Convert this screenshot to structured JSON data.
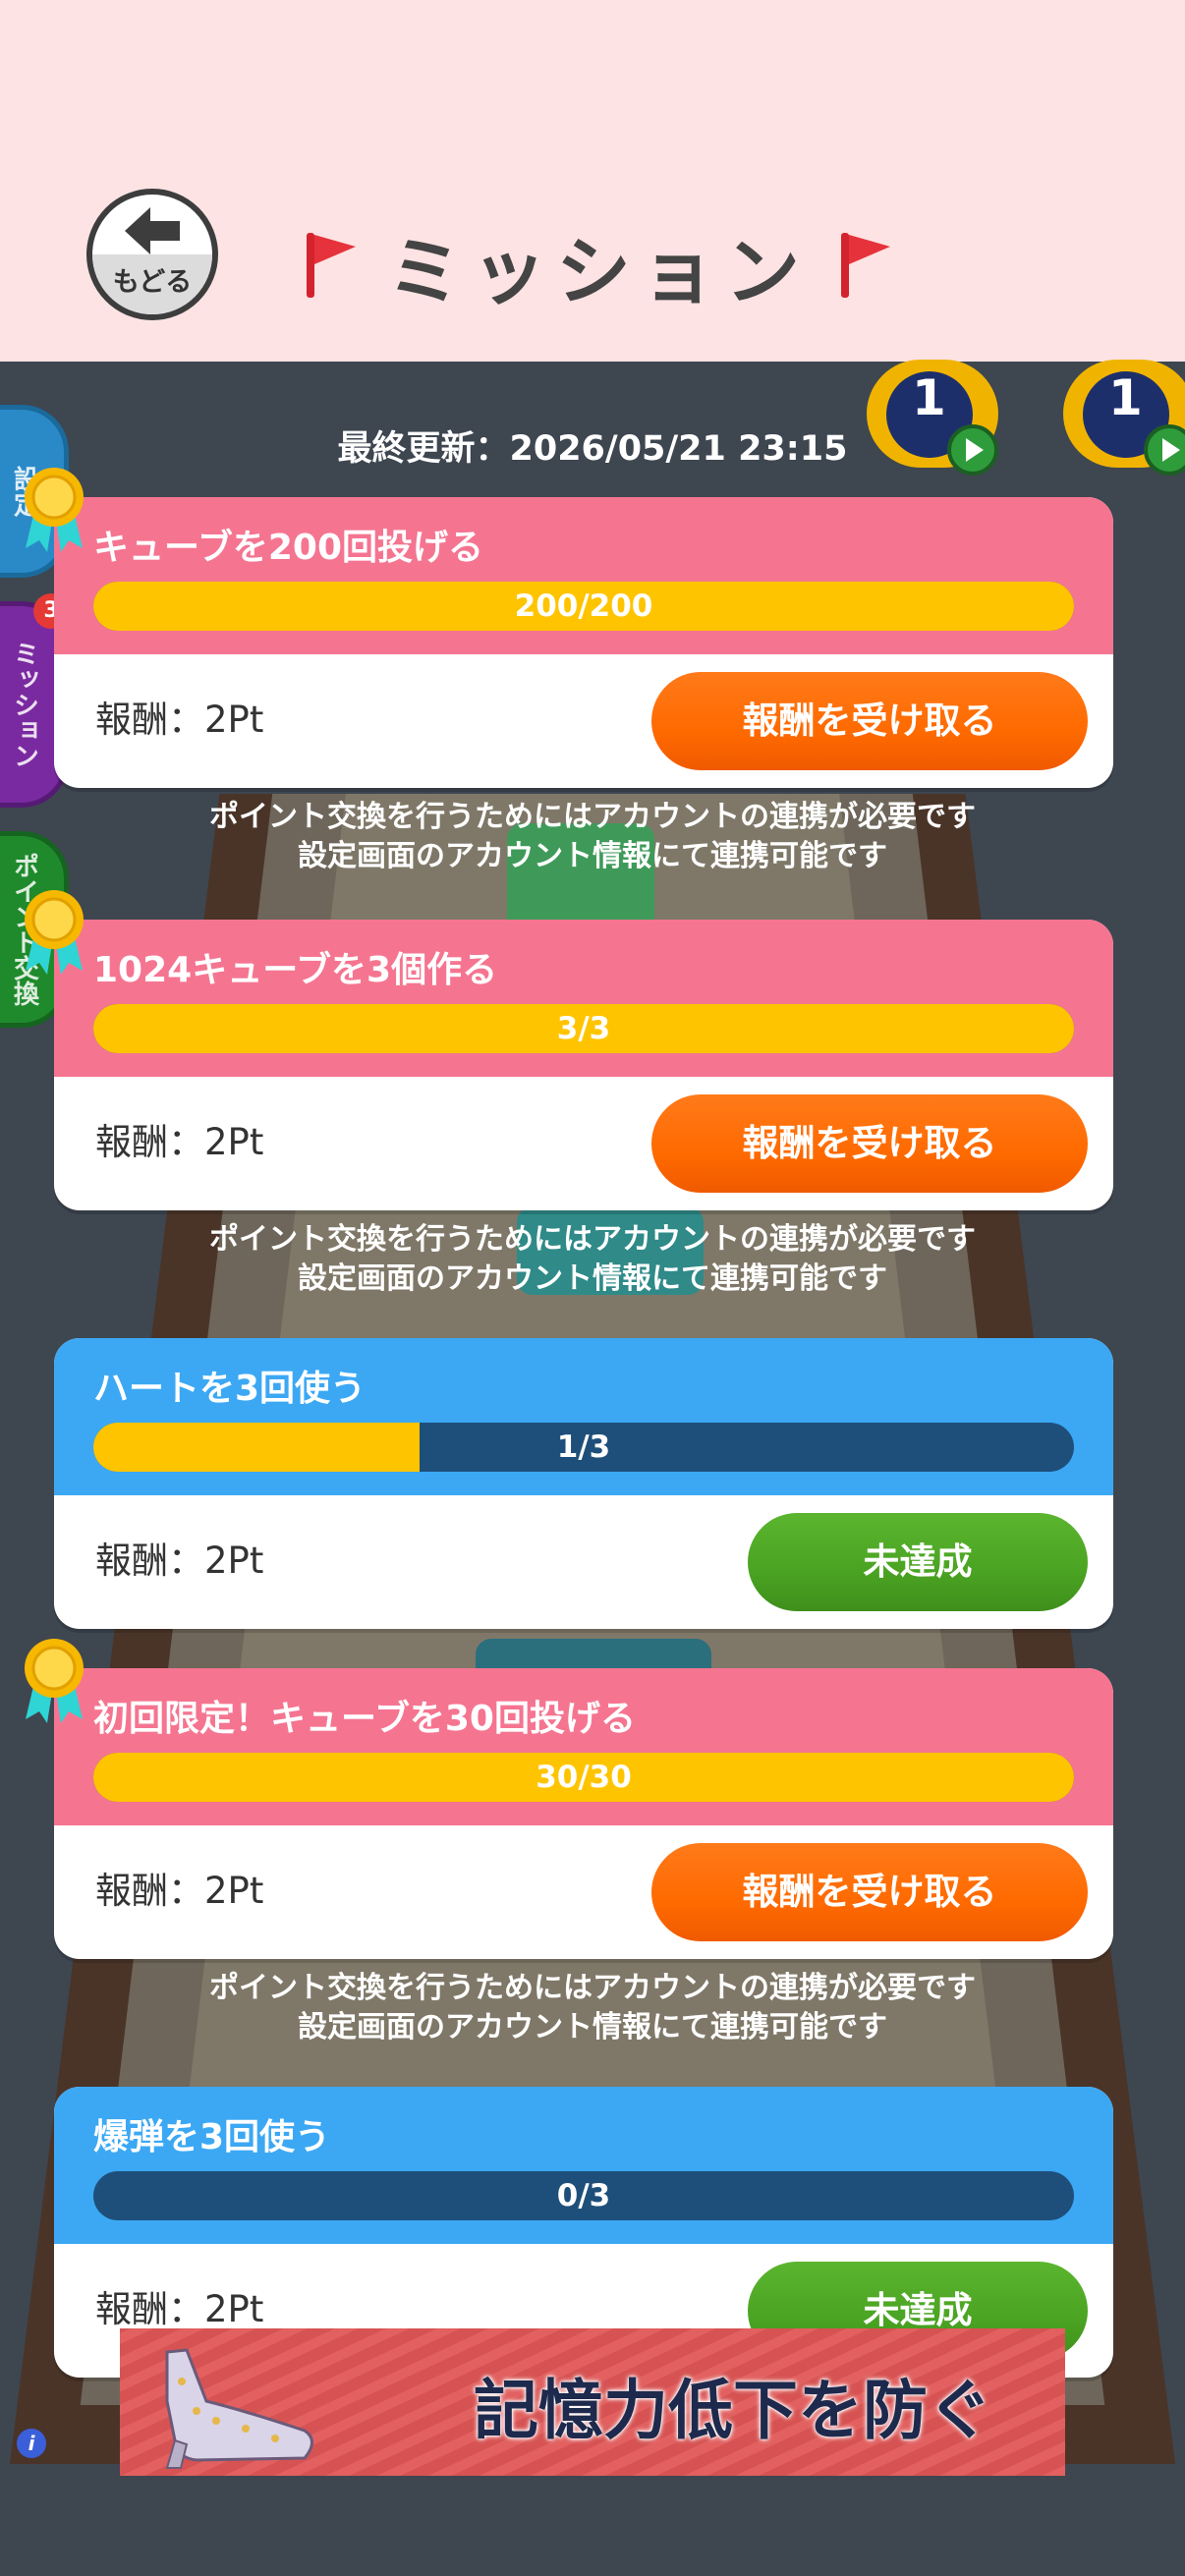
{
  "header": {
    "back_label": "もどる",
    "title": "ミッション"
  },
  "side_tabs": [
    "設定",
    "ミッション",
    "ポイント交換"
  ],
  "side_badge": "3",
  "powerups": [
    {
      "count": "1"
    },
    {
      "count": "1"
    }
  ],
  "last_updated": "最終更新：2026/05/21 23:15",
  "missions": [
    {
      "title": "キューブを200回投げる",
      "progress_text": "200/200",
      "progress": 1.0,
      "reward": "報酬：2Pt",
      "button": "報酬を受け取る",
      "status": "done",
      "note": [
        "ポイント交換を行うためにはアカウントの連携が必要です",
        "設定画面のアカウント情報にて連携可能です"
      ]
    },
    {
      "title": "1024キューブを3個作る",
      "progress_text": "3/3",
      "progress": 1.0,
      "reward": "報酬：2Pt",
      "button": "報酬を受け取る",
      "status": "done",
      "note": [
        "ポイント交換を行うためにはアカウントの連携が必要です",
        "設定画面のアカウント情報にて連携可能です"
      ]
    },
    {
      "title": "ハートを3回使う",
      "progress_text": "1/3",
      "progress": 0.333,
      "reward": "報酬：2Pt",
      "button": "未達成",
      "status": "todo"
    },
    {
      "title": "初回限定！キューブを30回投げる",
      "progress_text": "30/30",
      "progress": 1.0,
      "reward": "報酬：2Pt",
      "button": "報酬を受け取る",
      "status": "done",
      "note": [
        "ポイント交換を行うためにはアカウントの連携が必要です",
        "設定画面のアカウント情報にて連携可能です"
      ]
    },
    {
      "title": "爆弾を3回使う",
      "progress_text": "0/3",
      "progress": 0.0,
      "reward": "報酬：2Pt",
      "button": "未達成",
      "status": "todo"
    }
  ],
  "ad": {
    "text": "記憶力低下を防ぐ"
  },
  "colors": {
    "header_bg": "#fde3e3",
    "done_head": "#f57591",
    "todo_head": "#3ca8f4",
    "progress_fill": "#ffc400",
    "claim_button": "#ff6a00",
    "incomplete_button": "#4aa322"
  }
}
